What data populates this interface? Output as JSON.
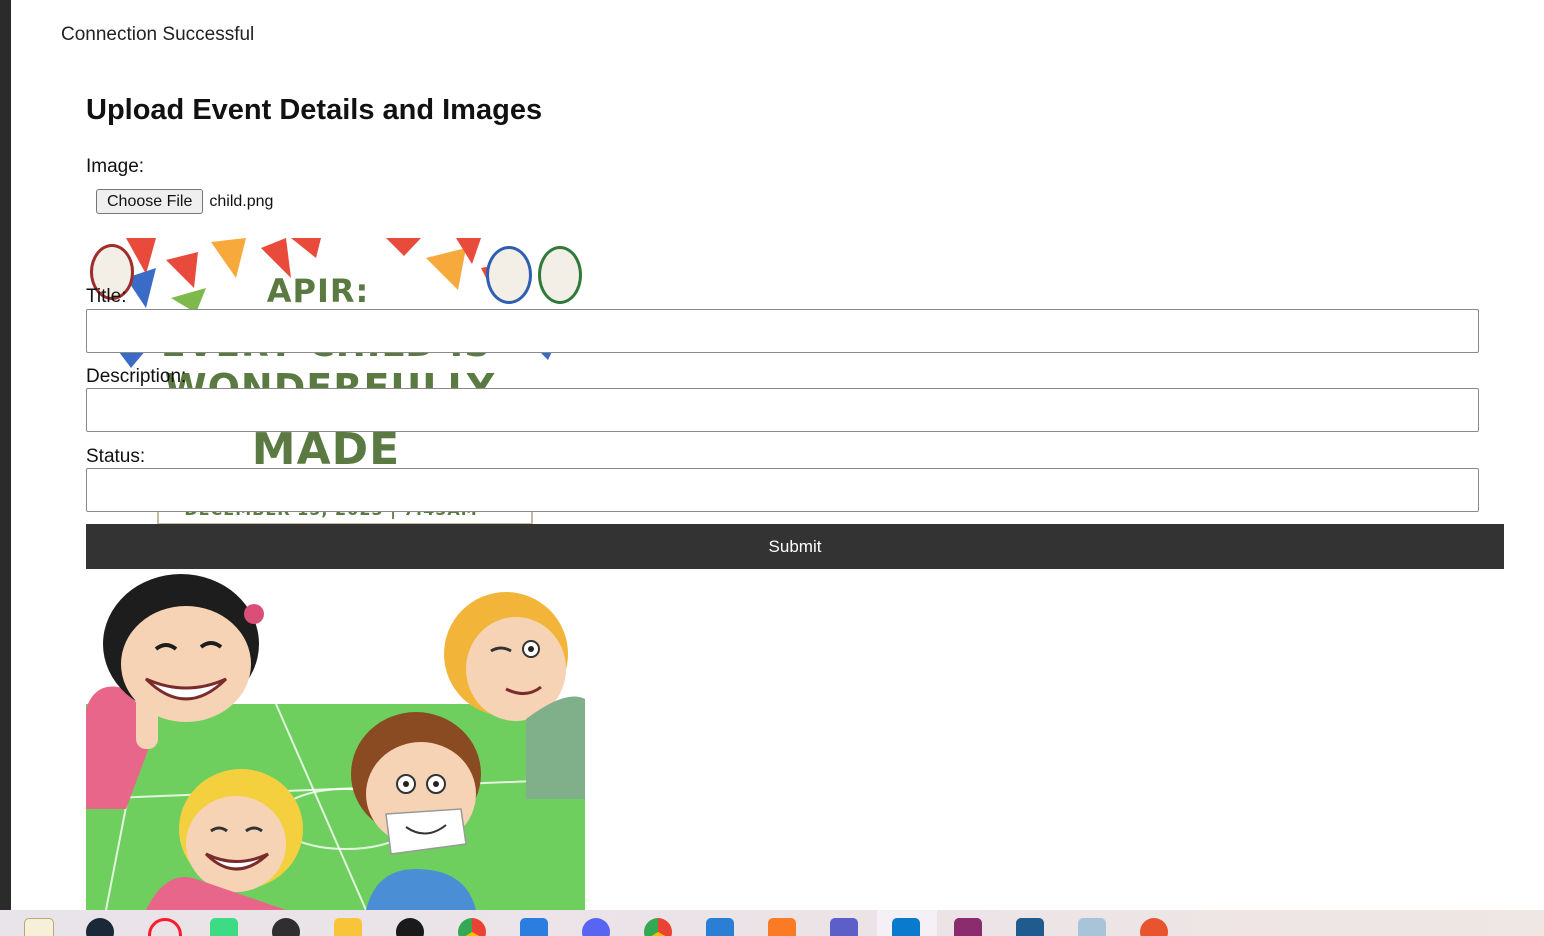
{
  "status_message": "Connection Successful",
  "form": {
    "heading": "Upload Event Details and Images",
    "image_label": "Image:",
    "choose_file_label": "Choose File",
    "selected_file": "child.png",
    "title_label": "Title:",
    "title_value": "",
    "description_label": "Description:",
    "description_value": "",
    "status_label": "Status:",
    "status_value": "",
    "submit_label": "Submit"
  },
  "poster_preview": {
    "lines": [
      "APIR:",
      "EVERY CHILD IS",
      "WONDERFULLY",
      "MADE",
      "DECEMBER 15, 2023 | 7:45AM"
    ]
  },
  "colors": {
    "submit_bg": "#333333",
    "poster_text": "#5a7a42",
    "field_green": "#6fcf5e"
  },
  "taskbar": {
    "icons": [
      "notepad-icon",
      "steam-icon",
      "opera-icon",
      "android-studio-icon",
      "obs-icon",
      "file-explorer-icon",
      "inkscape-icon",
      "chrome-icon",
      "photos-icon",
      "discord-icon",
      "chrome-alt-icon",
      "settings-icon",
      "xampp-icon",
      "teams-icon",
      "vscode-icon",
      "winrar-icon",
      "mysql-workbench-icon",
      "notepad-plus-icon",
      "git-icon"
    ]
  }
}
